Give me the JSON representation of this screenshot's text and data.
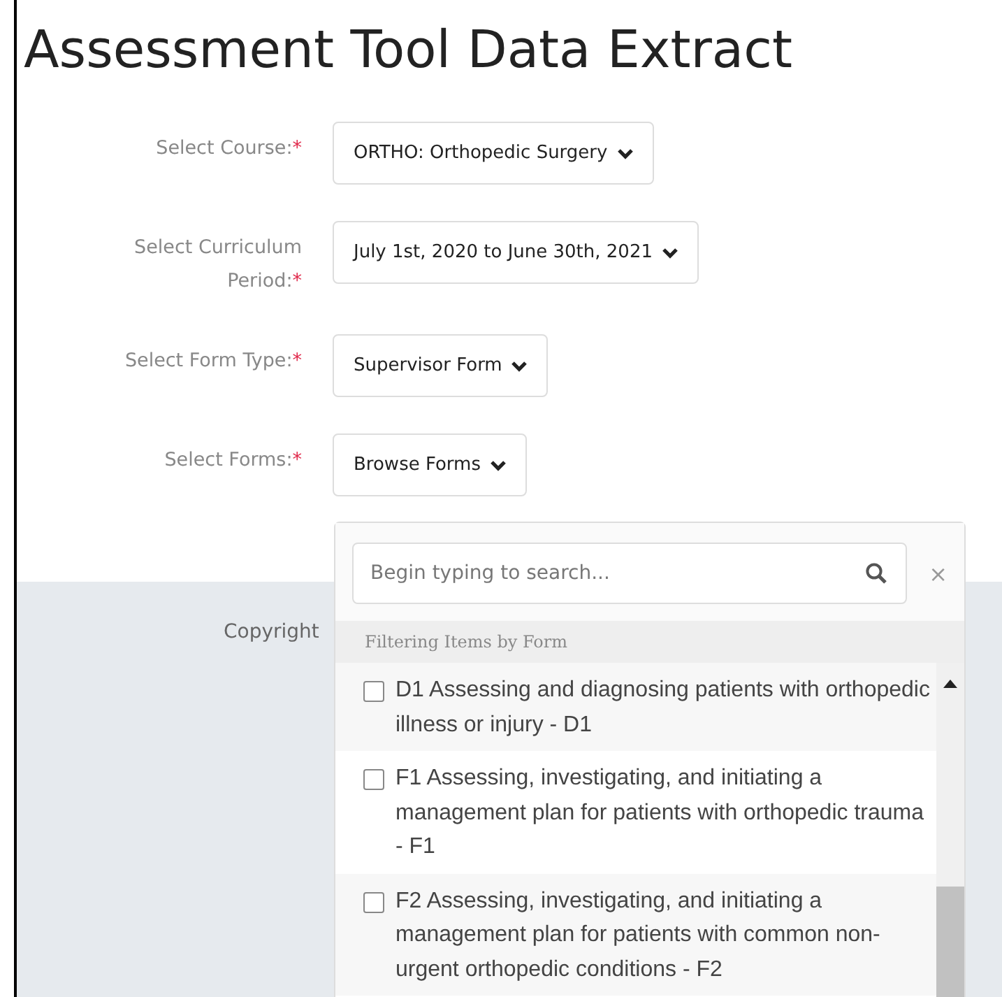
{
  "title": "Assessment Tool Data Extract",
  "fields": [
    {
      "label": "Select Course:",
      "required_mark": "*",
      "value": "ORTHO: Orthopedic Surgery"
    },
    {
      "label": "Select Curriculum Period:",
      "required_mark": "*",
      "value": "July 1st, 2020 to June 30th, 2021"
    },
    {
      "label": "Select Form Type:",
      "required_mark": "*",
      "value": "Supervisor Form"
    },
    {
      "label": "Select Forms:",
      "required_mark": "*",
      "value": "Browse Forms"
    }
  ],
  "footer": {
    "text": "Copyright"
  },
  "dropdown": {
    "search": {
      "placeholder": "Begin typing to search..."
    },
    "close": "×",
    "group": "Filtering Items by Form",
    "items": [
      {
        "label": "D1 Assessing and diagnosing patients with orthopedic illness or injury - D1",
        "checked": false
      },
      {
        "label": "F1 Assessing, investigating, and initiating a management plan for patients with orthopedic trauma - F1",
        "checked": false
      },
      {
        "label": "F2 Assessing, investigating, and initiating a management plan for patients with common non-urgent orthopedic conditions - F2",
        "checked": false
      }
    ]
  }
}
